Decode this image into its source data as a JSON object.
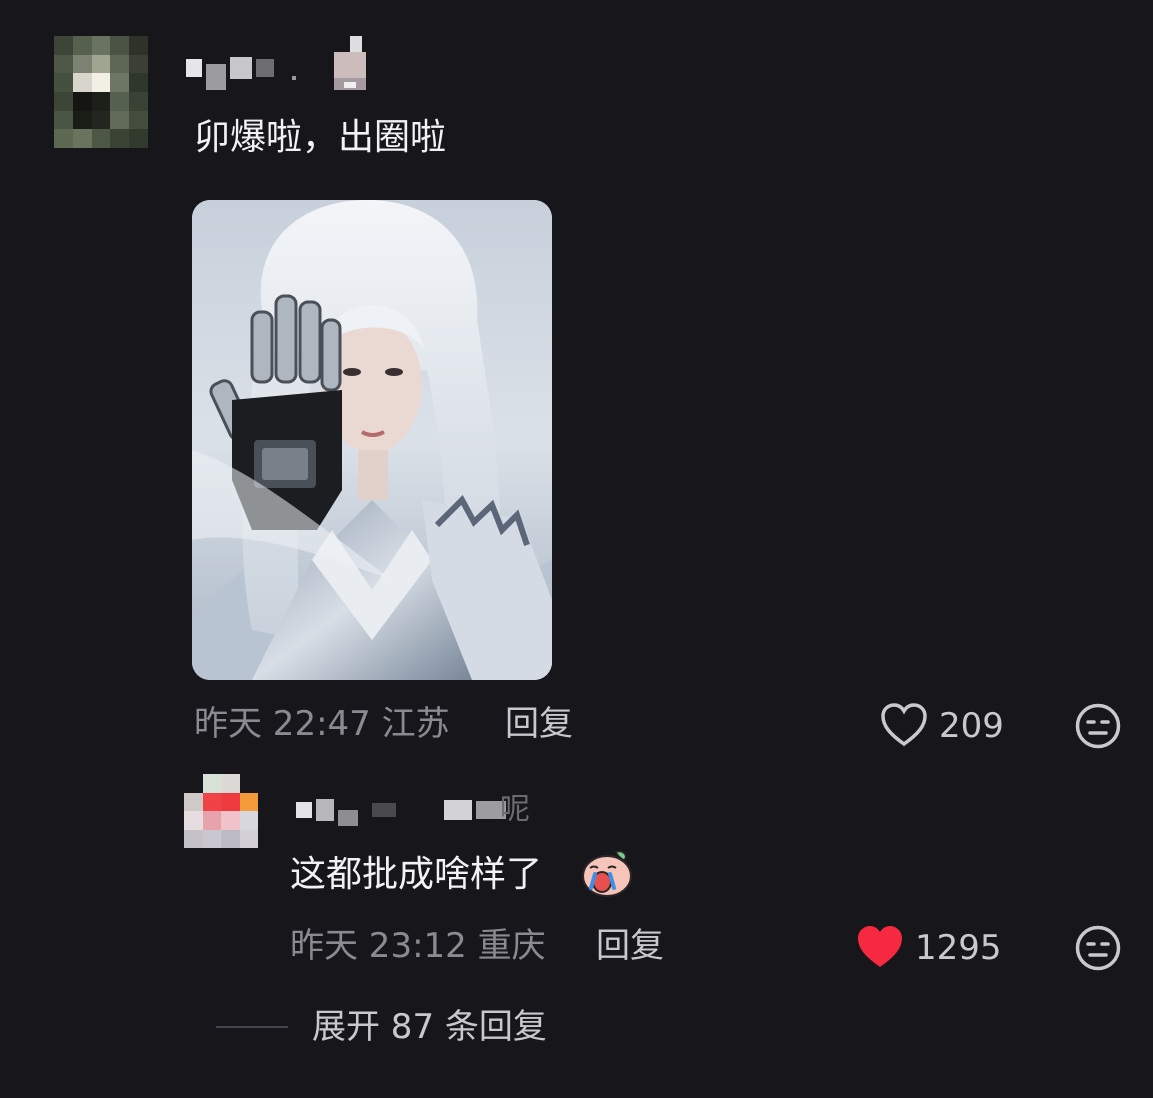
{
  "comment": {
    "text": "卯爆啦，出圈啦",
    "time": "昨天 22:47",
    "location": "江苏",
    "reply_label": "回复",
    "likes": "209",
    "liked": false,
    "image_icon": "portrait-photo"
  },
  "reply": {
    "text": "这都批成啥样了",
    "emoji_icon": "crying-face-sticker",
    "time": "昨天 23:12",
    "location": "重庆",
    "reply_label": "回复",
    "likes": "1295",
    "liked": true,
    "username_tail": "呢"
  },
  "expand": {
    "label": "展开 87 条回复"
  },
  "colors": {
    "background": "#17161b",
    "liked_heart": "#f5293f",
    "muted_text": "#8b8a90",
    "secondary_text": "#c9c8cd"
  }
}
